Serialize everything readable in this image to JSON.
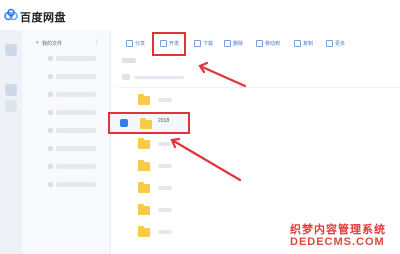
{
  "app": {
    "title": "百度网盘",
    "logo_icon": "baidu-cloud-logo-icon"
  },
  "sidebar": {
    "section_label": "我的文件"
  },
  "toolbar": {
    "buttons": [
      {
        "label": "分享",
        "icon": "share-icon"
      },
      {
        "label": "开发",
        "icon": "folder-new-icon"
      },
      {
        "label": "下载",
        "icon": "download-icon"
      },
      {
        "label": "删除",
        "icon": "delete-icon"
      },
      {
        "label": "移动到",
        "icon": "move-icon"
      },
      {
        "label": "复制",
        "icon": "copy-icon"
      },
      {
        "label": "更多",
        "icon": "more-icon"
      }
    ]
  },
  "files": {
    "selected_folder_name": "2018"
  },
  "watermark": {
    "line1": "织梦内容管理系统",
    "line2": "DEDECMS.COM"
  },
  "colors": {
    "accent": "#2f7fe6",
    "highlight": "#e03438",
    "folder": "#f9c94c"
  }
}
